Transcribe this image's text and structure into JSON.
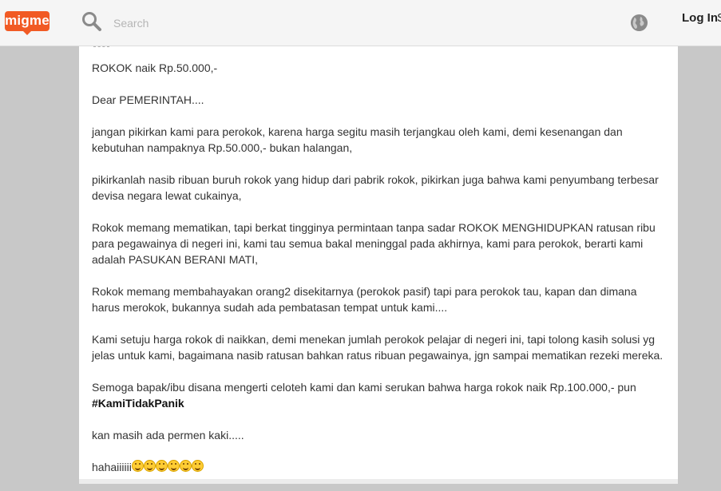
{
  "header": {
    "logo_text": "migme",
    "search_placeholder": "Search",
    "login_label": "Log In",
    "login_extra": "S",
    "brand_color": "#f15a24"
  },
  "post": {
    "title": "ROKOK naik Rp.50.000,-",
    "greeting": "Dear PEMERINTAH....",
    "paragraph1": "jangan pikirkan kami para perokok, karena harga segitu masih terjangkau oleh kami, demi kesenangan dan kebutuhan nampaknya Rp.50.000,- bukan halangan,",
    "paragraph2": "pikirkanlah nasib ribuan buruh rokok yang hidup dari pabrik rokok, pikirkan juga bahwa kami penyumbang terbesar devisa negara lewat cukainya,",
    "paragraph3": "Rokok memang mematikan, tapi berkat tingginya permintaan tanpa sadar ROKOK MENGHIDUPKAN ratusan ribu para pegawainya di negeri ini, kami tau semua bakal meninggal pada akhirnya, kami para perokok, berarti kami adalah PASUKAN BERANI MATI,",
    "paragraph4": "Rokok memang membahayakan orang2 disekitarnya (perokok pasif) tapi para perokok tau, kapan dan dimana harus merokok, bukannya sudah ada pembatasan tempat untuk kami....",
    "paragraph5": "Kami setuju harga rokok di naikkan, demi menekan jumlah perokok pelajar di negeri ini, tapi tolong kasih solusi yg jelas untuk kami, bagaimana nasib ratusan bahkan ratus ribuan pegawainya, jgn sampai mematikan rezeki mereka.",
    "paragraph6": "Semoga bapak/ibu disana mengerti celoteh kami dan kami serukan bahwa harga rokok naik Rp.100.000,- pun",
    "hashtag": "#KamiTidakPanik",
    "paragraph7": "kan masih ada permen kaki.....",
    "closing_text": "hahaiiiiii",
    "closing_emoji_names": [
      "grinning-tongue-emoji",
      "grinning-tongue-emoji",
      "grinning-tongue-emoji",
      "smile-emoji",
      "smile-emoji",
      "smile-emoji"
    ]
  }
}
